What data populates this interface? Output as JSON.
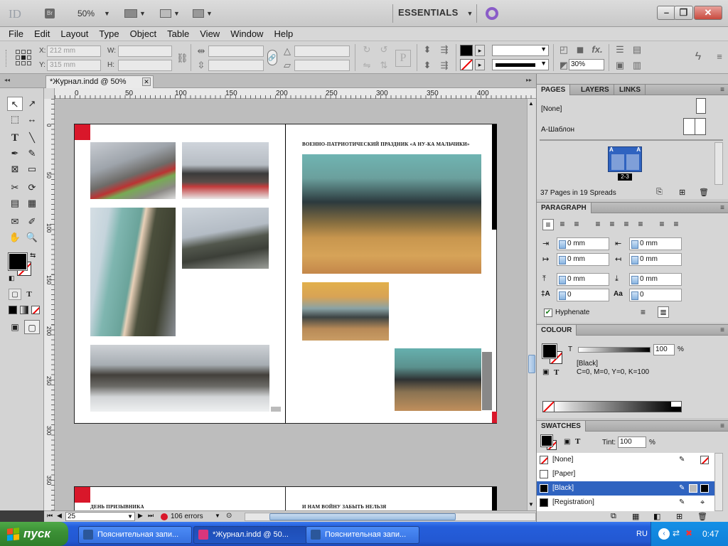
{
  "app": {
    "logo": "ID",
    "bridge": "Br",
    "zoom": "50%",
    "workspace": "ESSENTIALS"
  },
  "menu": [
    "File",
    "Edit",
    "Layout",
    "Type",
    "Object",
    "Table",
    "View",
    "Window",
    "Help"
  ],
  "control": {
    "x_label": "X:",
    "x_value": "212 mm",
    "y_label": "Y:",
    "y_value": "315 mm",
    "w_label": "W:",
    "h_label": "H:",
    "opacity": "30%"
  },
  "doc_tab": {
    "title": "*Журнал.indd @ 50%"
  },
  "ruler": {
    "h_ticks": [
      "0",
      "50",
      "100",
      "150",
      "200",
      "250",
      "300",
      "350",
      "400"
    ],
    "v_ticks": [
      "0",
      "50",
      "100",
      "150",
      "200",
      "250",
      "300",
      "350"
    ]
  },
  "pages": {
    "right_header": "ВОЕННО-ПАТРИОТИЧЕСКИЙ ПРАЗДНИК «А НУ-КА МАЛЬЧИКИ»",
    "bottom_left_header": "ДЕНЬ ПРИЗЫВНИКА",
    "bottom_right_header": "И НАМ ВОЙНУ ЗАБЫТЬ НЕЛЬЗЯ"
  },
  "status": {
    "page": "25",
    "errors": "106 errors"
  },
  "panels": {
    "pages": {
      "tabs": [
        "PAGES",
        "LAYERS",
        "LINKS"
      ],
      "masters": [
        "[None]",
        "A-Шаблон"
      ],
      "spread_label": "2-3",
      "master_letter": "A",
      "summary": "37 Pages in 19 Spreads"
    },
    "paragraph": {
      "title": "PARAGRAPH",
      "left_indent": "0 mm",
      "right_indent": "0 mm",
      "first_indent": "0 mm",
      "last_indent": "0 mm",
      "space_before": "0 mm",
      "space_after": "0 mm",
      "drop_lines": "0",
      "drop_chars": "0",
      "hyphenate": "Hyphenate"
    },
    "colour": {
      "title": "COLOUR",
      "channel": "T",
      "tint": "100",
      "percent": "%",
      "swatch_name": "[Black]",
      "cmyk": "C=0, M=0, Y=0, K=100"
    },
    "swatches": {
      "title": "SWATCHES",
      "tint_label": "Tint:",
      "tint": "100",
      "percent": "%",
      "items": [
        {
          "name": "[None]",
          "color": "none"
        },
        {
          "name": "[Paper]",
          "color": "#ffffff"
        },
        {
          "name": "[Black]",
          "color": "#000000"
        },
        {
          "name": "[Registration]",
          "color": "#000000"
        }
      ]
    }
  },
  "taskbar": {
    "start": "пуск",
    "items": [
      "Пояснительная запи...",
      "*Журнал.indd @ 50...",
      "Пояснительная запи..."
    ],
    "lang": "RU",
    "time": "0:47"
  },
  "colors": {
    "accent": "#d9172a",
    "selection": "#2f63c0",
    "taskbar": "#245edb",
    "start": "#3c9136"
  }
}
